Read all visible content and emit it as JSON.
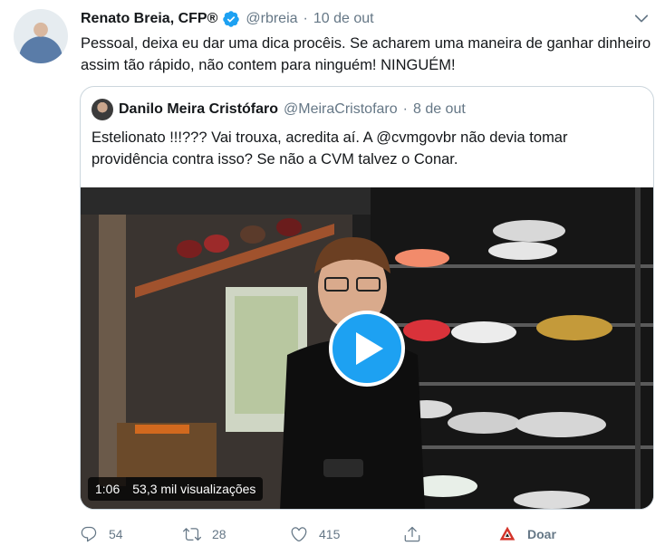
{
  "tweet": {
    "author_name": "Renato Breia, CFP®",
    "handle": "@rbreia",
    "separator": "·",
    "date": "10 de out",
    "text": "Pessoal, deixa eu dar uma dica procêis. Se acharem uma maneira de ganhar dinheiro assim tão rápido, não contem para ninguém! NINGUÉM!"
  },
  "quoted": {
    "author_name": "Danilo Meira Cristófaro",
    "handle": "@MeiraCristofaro",
    "separator": "·",
    "date": "8 de out",
    "text": "Estelionato !!!??? Vai trouxa, acredita aí. A @cvmgovbr não devia tomar providência contra isso? Se não a CVM talvez o Conar.",
    "video": {
      "duration": "1:06",
      "views": "53,3 mil visualizações"
    }
  },
  "actions": {
    "reply_count": "54",
    "retweet_count": "28",
    "like_count": "415",
    "donate_label": "Doar"
  },
  "colors": {
    "accent": "#1da1f2",
    "secondary_text": "#657786",
    "donate": "#d4342a"
  },
  "icons": [
    "verified-icon",
    "chevron-down-icon",
    "reply-icon",
    "retweet-icon",
    "like-icon",
    "share-icon",
    "donate-icon",
    "play-icon"
  ]
}
